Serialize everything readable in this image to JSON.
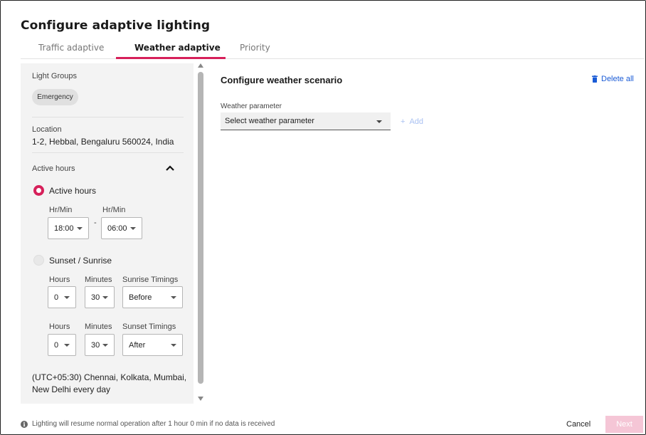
{
  "title": "Configure adaptive lighting",
  "tabs": [
    {
      "label": "Traffic adaptive"
    },
    {
      "label": "Weather adaptive"
    },
    {
      "label": "Priority"
    }
  ],
  "active_tab": "Weather adaptive",
  "accent_color": "#d6205a",
  "left_panel": {
    "light_groups_label": "Light Groups",
    "light_group_chip": "Emergency",
    "location_label": "Location",
    "location_value": "1-2, Hebbal, Bengaluru 560024, India",
    "active_hours_section": "Active hours",
    "active_hours_option": {
      "label": "Active hours",
      "selected": true,
      "from_label": "Hr/Min",
      "from_value": "18:00",
      "separator": "-",
      "to_label": "Hr/Min",
      "to_value": "06:00"
    },
    "sunset_option": {
      "label": "Sunset / Sunrise",
      "selected": false,
      "sunrise": {
        "hours_label": "Hours",
        "hours_value": "0",
        "minutes_label": "Minutes",
        "minutes_value": "30",
        "timing_label": "Sunrise Timings",
        "timing_value": "Before"
      },
      "sunset": {
        "hours_label": "Hours",
        "hours_value": "0",
        "minutes_label": "Minutes",
        "minutes_value": "30",
        "timing_label": "Sunset Timings",
        "timing_value": "After"
      }
    },
    "timezone_text": "(UTC+05:30) Chennai, Kolkata, Mumbai, New Delhi every day"
  },
  "right_panel": {
    "section_title": "Configure weather scenario",
    "delete_all": "Delete all",
    "weather_param_label": "Weather parameter",
    "weather_param_placeholder": "Select weather parameter",
    "add_label": "Add"
  },
  "footer": {
    "info_text": "Lighting will resume normal operation after 1 hour 0 min if no data is received",
    "cancel": "Cancel",
    "next": "Next"
  }
}
